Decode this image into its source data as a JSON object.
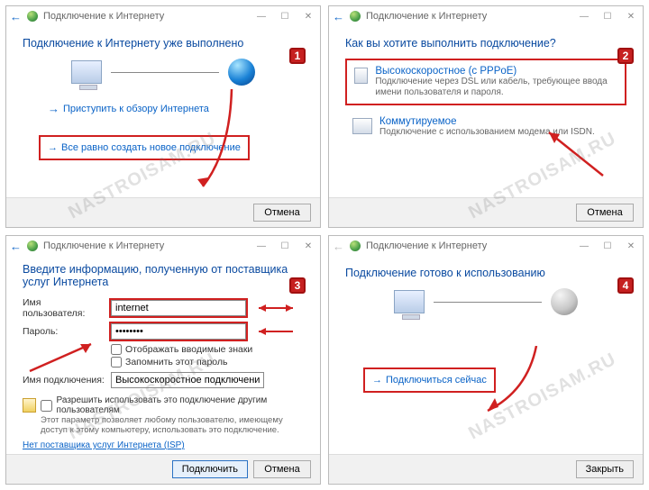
{
  "window_title": "Подключение к Интернету",
  "steps": {
    "s1": "1",
    "s2": "2",
    "s3": "3",
    "s4": "4"
  },
  "buttons": {
    "cancel": "Отмена",
    "connect": "Подключить",
    "close": "Закрыть"
  },
  "panel1": {
    "heading": "Подключение к Интернету уже выполнено",
    "browse_link": "Приступить к обзору Интернета",
    "create_new": "Все равно создать новое подключение"
  },
  "panel2": {
    "heading": "Как вы хотите выполнить подключение?",
    "opt1_title": "Высокоскоростное (с PPPoE)",
    "opt1_desc": "Подключение через DSL или кабель, требующее ввода имени пользователя и пароля.",
    "opt2_title": "Коммутируемое",
    "opt2_desc": "Подключение с использованием модема или ISDN."
  },
  "panel3": {
    "heading": "Введите информацию, полученную от поставщика услуг Интернета",
    "labels": {
      "username": "Имя пользователя:",
      "password": "Пароль:",
      "conn_name": "Имя подключения:"
    },
    "values": {
      "username": "internet",
      "password": "••••••••",
      "conn_name": "Высокоскоростное подключение"
    },
    "checks": {
      "show_chars": "Отображать вводимые знаки",
      "remember": "Запомнить этот пароль"
    },
    "allow_others": "Разрешить использовать это подключение другим пользователям",
    "allow_others_desc": "Этот параметр позволяет любому пользователю, имеющему доступ к этому компьютеру, использовать это подключение.",
    "no_isp": "Нет поставщика услуг Интернета (ISP)"
  },
  "panel4": {
    "heading": "Подключение готово к использованию",
    "connect_now": "Подключиться сейчас"
  },
  "watermark": "NASTROISAM.RU",
  "icons": {
    "back": "←",
    "arrow": "→",
    "min": "—",
    "max": "☐",
    "close": "✕"
  }
}
